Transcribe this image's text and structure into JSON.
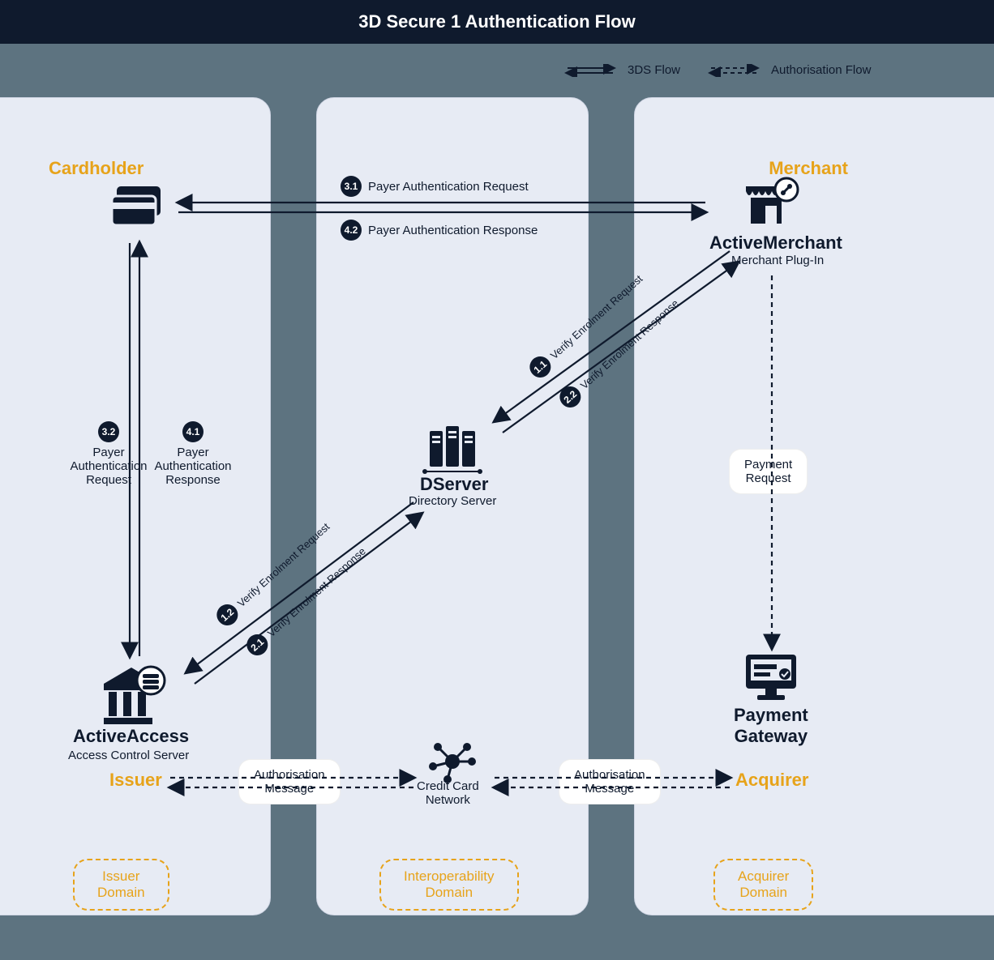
{
  "title": "3D Secure 1  Authentication Flow",
  "legend": {
    "flow": "3DS Flow",
    "auth": "Authorisation Flow"
  },
  "columns": {
    "left": {
      "domain": "Issuer\nDomain"
    },
    "mid": {
      "domain": "Interoperability\nDomain"
    },
    "right": {
      "domain": "Acquirer\nDomain"
    }
  },
  "nodes": {
    "cardholder": {
      "title": "Cardholder"
    },
    "merchant": {
      "title": "Merchant",
      "product": "ActiveMerchant",
      "sub": "Merchant Plug-In"
    },
    "dserver": {
      "product": "DServer",
      "sub": "Directory Server"
    },
    "activeaccess": {
      "product": "ActiveAccess",
      "sub": "Access Control Server"
    },
    "issuer": {
      "title": "Issuer"
    },
    "acquirer": {
      "title": "Acquirer"
    },
    "ccn": {
      "title": "Credit Card\nNetwork"
    },
    "gateway": {
      "title": "Payment\nGateway"
    }
  },
  "flows": {
    "f11": {
      "num": "1.1",
      "text": "Verify Enrolment Request"
    },
    "f12": {
      "num": "1.2",
      "text": "Verify Enrolment Request"
    },
    "f21": {
      "num": "2.1",
      "text": "Verify Enrolment Response"
    },
    "f22": {
      "num": "2.2",
      "text": "Verify Enrolment Response"
    },
    "f31": {
      "num": "3.1",
      "text": "Payer Authentication Request"
    },
    "f32": {
      "num": "3.2",
      "text": "Payer\nAuthentication\nRequest"
    },
    "f41": {
      "num": "4.1",
      "text": "Payer\nAuthentication\nResponse"
    },
    "f42": {
      "num": "4.2",
      "text": "Payer Authentication Response"
    },
    "pay": {
      "text": "Payment\nRequest"
    },
    "authmsg": {
      "text": "Authorisation\nMessage"
    }
  }
}
